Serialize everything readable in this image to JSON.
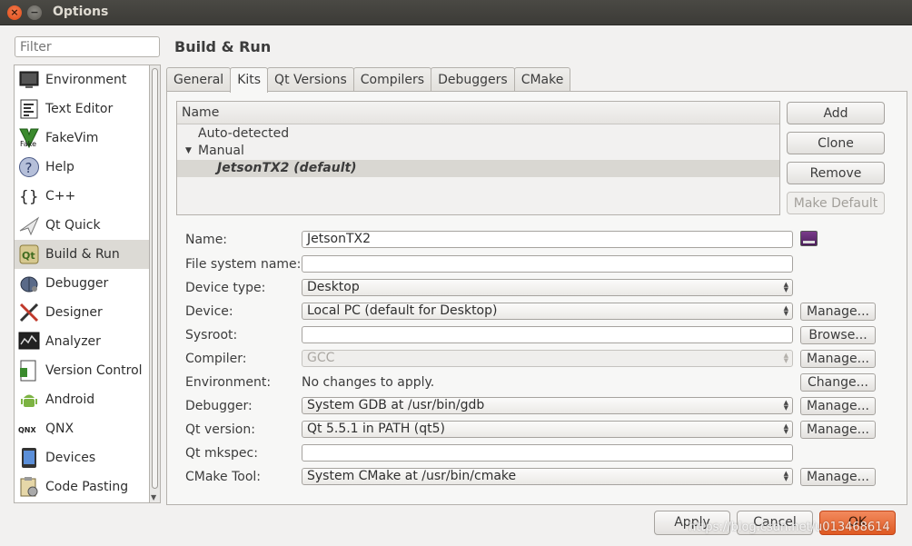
{
  "window": {
    "title": "Options",
    "close_glyph": "×",
    "minimize_glyph": "−"
  },
  "filter": {
    "placeholder": "Filter"
  },
  "nav": {
    "items": [
      {
        "label": "Environment",
        "icon": "monitor-icon"
      },
      {
        "label": "Text Editor",
        "icon": "text-editor-icon"
      },
      {
        "label": "FakeVim",
        "icon": "fakevim-icon",
        "icon_text": "Fake"
      },
      {
        "label": "Help",
        "icon": "help-icon",
        "icon_text": "?"
      },
      {
        "label": "C++",
        "icon": "cpp-braces-icon",
        "icon_text": "{}"
      },
      {
        "label": "Qt Quick",
        "icon": "qt-quick-icon"
      },
      {
        "label": "Build & Run",
        "icon": "build-run-icon",
        "icon_text": "Qt",
        "selected": true
      },
      {
        "label": "Debugger",
        "icon": "debugger-bug-icon"
      },
      {
        "label": "Designer",
        "icon": "designer-tools-icon"
      },
      {
        "label": "Analyzer",
        "icon": "analyzer-icon"
      },
      {
        "label": "Version Control",
        "icon": "version-control-icon"
      },
      {
        "label": "Android",
        "icon": "android-icon"
      },
      {
        "label": "QNX",
        "icon": "qnx-icon",
        "icon_text": "QNX"
      },
      {
        "label": "Devices",
        "icon": "devices-icon"
      },
      {
        "label": "Code Pasting",
        "icon": "code-pasting-icon"
      }
    ]
  },
  "page": {
    "title": "Build & Run"
  },
  "tabs": [
    {
      "label": "General"
    },
    {
      "label": "Kits",
      "active": true
    },
    {
      "label": "Qt Versions"
    },
    {
      "label": "Compilers"
    },
    {
      "label": "Debuggers"
    },
    {
      "label": "CMake"
    }
  ],
  "kits_tree": {
    "header": "Name",
    "auto_detected": "Auto-detected",
    "manual": "Manual",
    "manual_caret": "▼",
    "selected_kit": "JetsonTX2 (default)"
  },
  "kit_buttons": {
    "add": "Add",
    "clone": "Clone",
    "remove": "Remove",
    "make_default": "Make Default"
  },
  "form": {
    "name": {
      "label": "Name:",
      "value": "JetsonTX2"
    },
    "file_system_name": {
      "label": "File system name:",
      "value": ""
    },
    "device_type": {
      "label": "Device type:",
      "value": "Desktop"
    },
    "device": {
      "label": "Device:",
      "value": "Local PC (default for Desktop)",
      "button": "Manage..."
    },
    "sysroot": {
      "label": "Sysroot:",
      "value": "",
      "button": "Browse..."
    },
    "compiler": {
      "label": "Compiler:",
      "value": "GCC",
      "button": "Manage..."
    },
    "environment": {
      "label": "Environment:",
      "value": "No changes to apply.",
      "button": "Change..."
    },
    "debugger": {
      "label": "Debugger:",
      "value": "System GDB at /usr/bin/gdb",
      "button": "Manage..."
    },
    "qt_version": {
      "label": "Qt version:",
      "value": "Qt 5.5.1 in PATH (qt5)",
      "button": "Manage..."
    },
    "qt_mkspec": {
      "label": "Qt mkspec:",
      "value": ""
    },
    "cmake_tool": {
      "label": "CMake Tool:",
      "value": "System CMake at /usr/bin/cmake",
      "button": "Manage..."
    }
  },
  "dialog_buttons": {
    "apply": "Apply",
    "cancel": "Cancel",
    "ok": "OK"
  },
  "spin_glyph": {
    "up": "▲",
    "down": "▼"
  },
  "watermark": "https://blog.csdn.net/u013468614",
  "colors": {
    "ok_button": "#e05a22",
    "selection": "#dcdad5",
    "close_button": "#df4a16"
  }
}
